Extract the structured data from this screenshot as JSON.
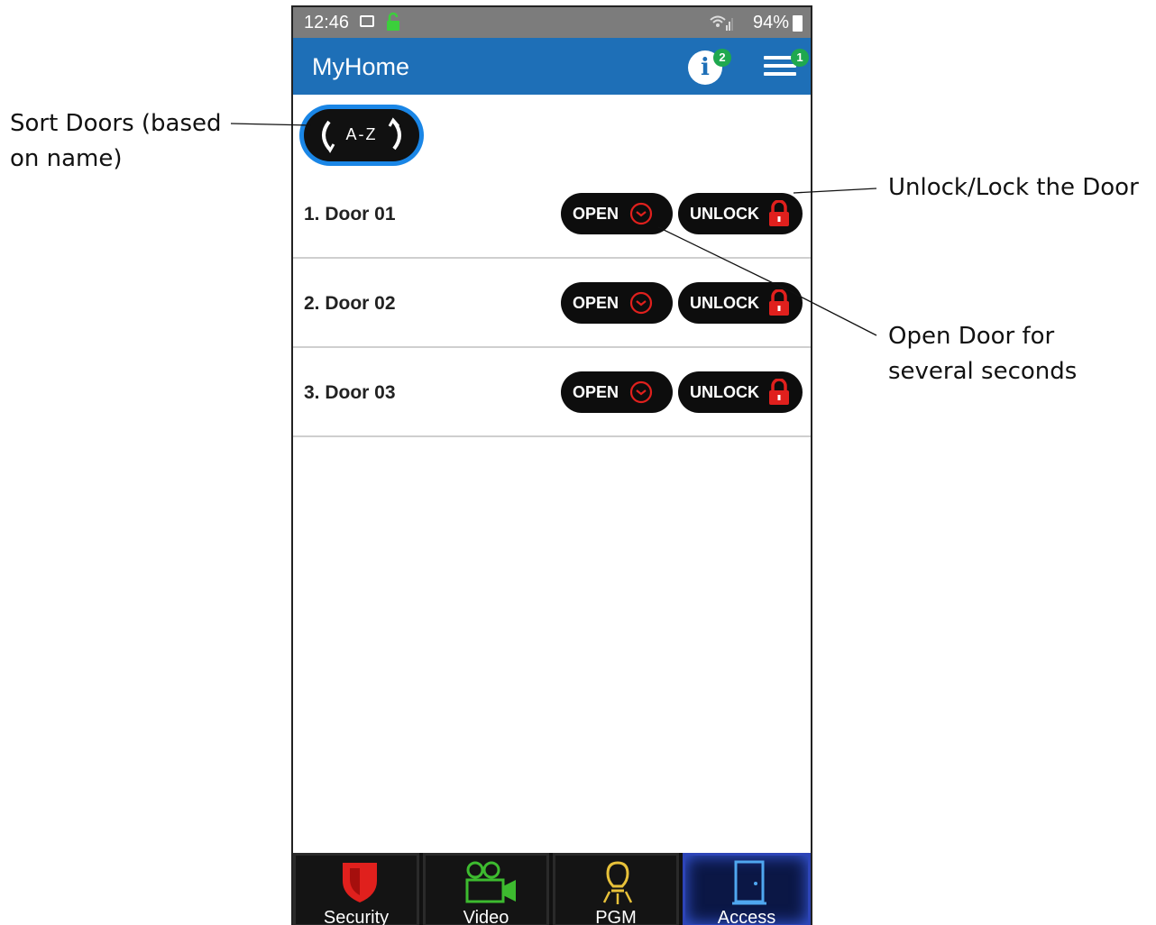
{
  "status_bar": {
    "time": "12:46",
    "battery": "94%"
  },
  "app_bar": {
    "title": "MyHome",
    "info_badge": "2",
    "menu_badge": "1"
  },
  "sort_button": {
    "label": "A-Z"
  },
  "doors": [
    {
      "name": "1. Door 01",
      "open_label": "OPEN",
      "unlock_label": "UNLOCK"
    },
    {
      "name": "2. Door 02",
      "open_label": "OPEN",
      "unlock_label": "UNLOCK"
    },
    {
      "name": "3. Door 03",
      "open_label": "OPEN",
      "unlock_label": "UNLOCK"
    }
  ],
  "tabs": [
    {
      "label": "Security",
      "icon": "shield-icon",
      "color": "#e0201d"
    },
    {
      "label": "Video",
      "icon": "camera-icon",
      "color": "#3dbb2f"
    },
    {
      "label": "PGM",
      "icon": "lightbulb-icon",
      "color": "#e8c23a"
    },
    {
      "label": "Access",
      "icon": "door-icon",
      "color": "#4fa7f0",
      "active": true
    }
  ],
  "annotations": {
    "sort": [
      "Sort Doors (based",
      "on name)"
    ],
    "unlock": "Unlock/Lock the Door",
    "open": [
      "Open Door for",
      "several seconds"
    ]
  },
  "colors": {
    "app_bar": "#1e6fb7",
    "status_bar": "#7c7c7c",
    "badge": "#1fa84f",
    "icon_red": "#e0201d"
  }
}
